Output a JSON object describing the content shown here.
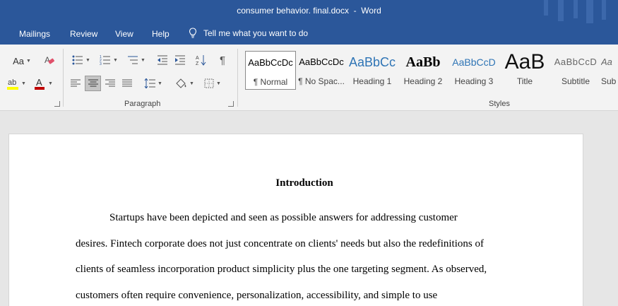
{
  "window": {
    "title": "consumer behavior. final.docx  -  Word"
  },
  "menu": {
    "tabs": [
      "Mailings",
      "Review",
      "View",
      "Help"
    ],
    "tell_me": "Tell me what you want to do"
  },
  "ribbon": {
    "font_size_label": "Aa",
    "paragraph_group_label": "Paragraph",
    "styles_group_label": "Styles",
    "styles": [
      {
        "preview": "AaBbCcDc",
        "name": "¶ Normal",
        "selected": true
      },
      {
        "preview": "AaBbCcDc",
        "name": "¶ No Spac..."
      },
      {
        "preview": "AaBbCc",
        "name": "Heading 1"
      },
      {
        "preview": "AaBb",
        "name": "Heading 2"
      },
      {
        "preview": "AaBbCcD",
        "name": "Heading 3"
      },
      {
        "preview": "AaB",
        "name": "Title"
      },
      {
        "preview": "AaBbCcD",
        "name": "Subtitle"
      },
      {
        "preview": "Aa",
        "name": "Sub"
      }
    ]
  },
  "document": {
    "heading": "Introduction",
    "lines": [
      "Startups have been depicted and seen as possible answers for addressing customer",
      "desires. Fintech corporate does not just concentrate on clients' needs but also the redefinitions of",
      "clients of seamless incorporation product simplicity plus the one targeting segment. As observed,",
      "customers often require convenience, personalization, accessibility, and simple to use"
    ]
  },
  "colors": {
    "title_bar": "#2b579a",
    "ribbon": "#f3f3f3",
    "highlight": "#ffff00",
    "font_color": "#c00000",
    "heading_blue": "#2e74b5"
  }
}
